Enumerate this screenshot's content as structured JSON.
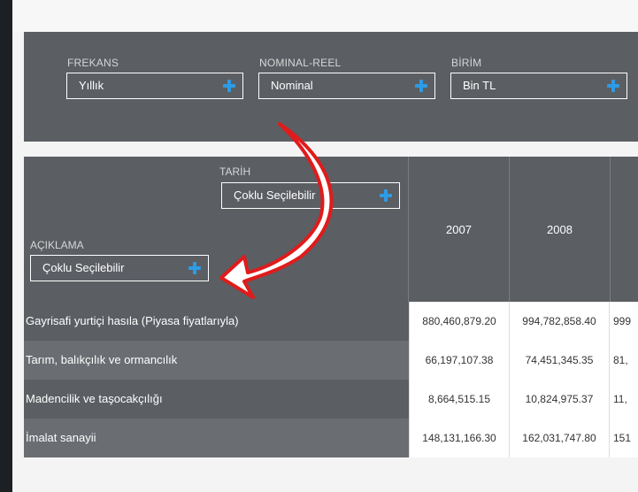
{
  "filters": [
    {
      "label": "FREKANS",
      "value": "Yıllık"
    },
    {
      "label": "NOMINAL-REEL",
      "value": "Nominal"
    },
    {
      "label": "BİRİM",
      "value": "Bin TL"
    }
  ],
  "table": {
    "date_header": {
      "label": "TARİH",
      "value": "Çoklu Seçilebilir"
    },
    "desc_header": {
      "label": "AÇIKLAMA",
      "value": "Çoklu Seçilebilir"
    },
    "years": [
      "2007",
      "2008"
    ],
    "rows": [
      {
        "label": "Gayrisafi yurtiçi hasıla (Piyasa fiyatlarıyla)",
        "values": [
          "880,460,879.20",
          "994,782,858.40",
          "999"
        ]
      },
      {
        "label": "Tarım, balıkçılık ve ormancılık",
        "values": [
          "66,197,107.38",
          "74,451,345.35",
          "81,"
        ]
      },
      {
        "label": "Madencilik ve taşocakçılığı",
        "values": [
          "8,664,515.15",
          "10,824,975.37",
          "11,"
        ]
      },
      {
        "label": "İmalat sanayii",
        "values": [
          "148,131,166.30",
          "162,031,747.80",
          "151"
        ]
      }
    ]
  },
  "colors": {
    "panel": "#5b5e63",
    "accent": "#2e9be6",
    "arrow": "#e01b1b"
  }
}
